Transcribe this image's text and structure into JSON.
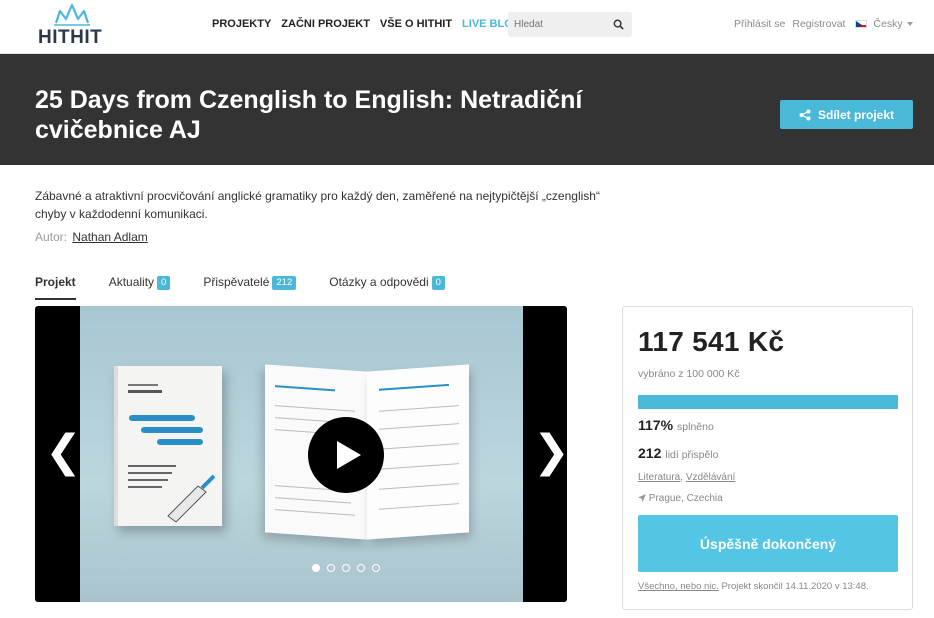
{
  "header": {
    "logo_text": "HITHIT",
    "nav": [
      "PROJEKTY",
      "ZAČNI PROJEKT",
      "VŠE O HITHIT",
      "LIVE BLOG"
    ],
    "search_placeholder": "Hledat",
    "login": "Přihlásit se",
    "register": "Registrovat",
    "language": "Česky"
  },
  "project": {
    "title": "25 Days from Czenglish to English: Netradiční cvičebnice AJ",
    "share_label": "Sdílet projekt",
    "description": "Zábavné a atraktivní procvičování anglické gramatiky pro každý den, zaměřené na nejtypičtější „czenglish“ chyby v každodenní komunikaci.",
    "author_label": "Autor:",
    "author_name": "Nathan Adlam"
  },
  "tabs": [
    {
      "label": "Projekt",
      "count": null
    },
    {
      "label": "Aktuality",
      "count": "0"
    },
    {
      "label": "Přispěvatelé",
      "count": "212"
    },
    {
      "label": "Otázky a odpovědi",
      "count": "0"
    }
  ],
  "gallery": {
    "slide_count": 5,
    "active_slide": 1
  },
  "stats": {
    "amount": "117 541 Kč",
    "goal_text": "vybráno z 100 000 Kč",
    "progress_fraction": 1.0,
    "percent": "117%",
    "percent_label": "splněno",
    "backers": "212",
    "backers_label": "lidí přispělo",
    "category_1": "Literatura",
    "category_2": "Vzdělávání",
    "location": "Prague, Czechia",
    "status_button": "Úspěšně dokončený",
    "footer_link": "Všechno, nebo nic.",
    "footer_text": "Projekt skončil 14.11.2020 v 13:48."
  },
  "colors": {
    "accent": "#4ab8d9",
    "banner": "#333333"
  },
  "icons": [
    "hithit-crown-icon",
    "search-icon",
    "czech-flag-icon",
    "share-icon",
    "location-arrow-icon",
    "play-icon"
  ]
}
